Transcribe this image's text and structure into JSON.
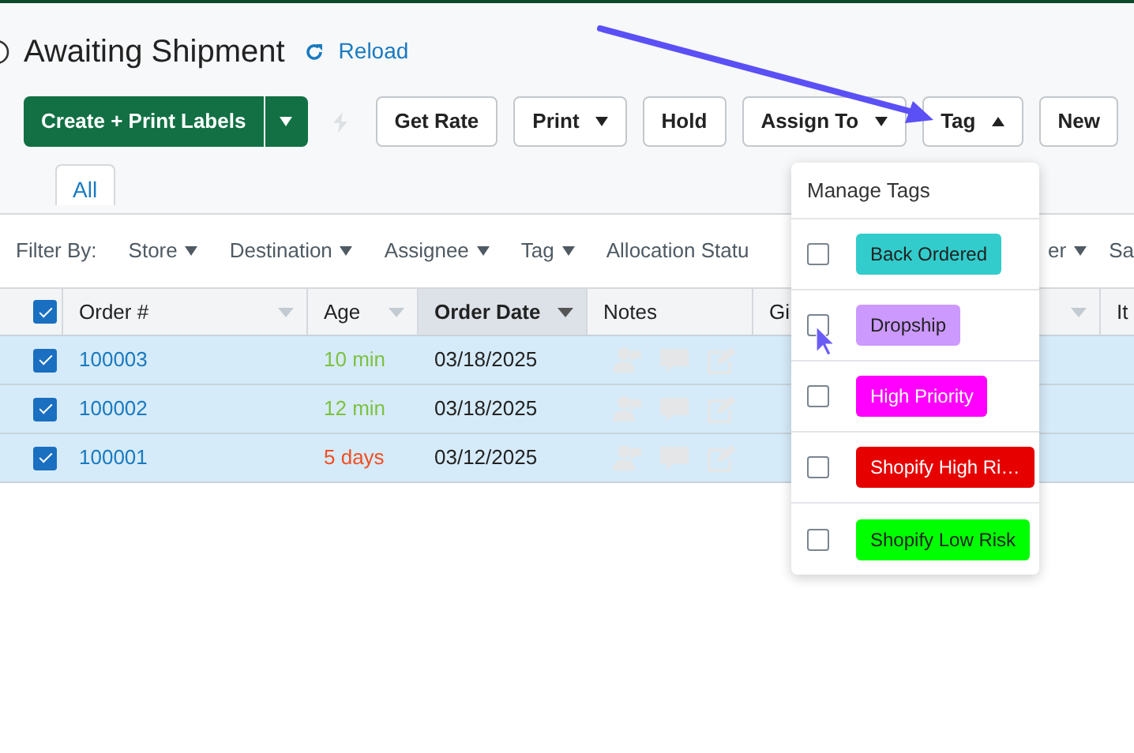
{
  "header": {
    "title": "Awaiting Shipment",
    "reload": "Reload"
  },
  "toolbar": [
    {
      "kind": "split",
      "label": "Create + Print Labels"
    },
    {
      "kind": "icon"
    },
    {
      "kind": "button",
      "label": "Get Rate"
    },
    {
      "kind": "dropdown",
      "label": "Print",
      "expanded": false
    },
    {
      "kind": "button",
      "label": "Hold"
    },
    {
      "kind": "dropdown",
      "label": "Assign To",
      "expanded": false
    },
    {
      "kind": "dropdown",
      "label": "Tag",
      "expanded": true
    },
    {
      "kind": "button",
      "label": "New"
    }
  ],
  "tabs": [
    {
      "label": "All",
      "selected": true
    }
  ],
  "filters": {
    "label": "Filter By:",
    "items": [
      {
        "kind": "dropdown",
        "label": "Store"
      },
      {
        "kind": "dropdown",
        "label": "Destination"
      },
      {
        "kind": "dropdown",
        "label": "Assignee"
      },
      {
        "kind": "dropdown",
        "label": "Tag"
      },
      {
        "kind": "text",
        "label": "Allocation Statu"
      },
      {
        "kind": "gap"
      },
      {
        "kind": "dropdown",
        "label": "er"
      },
      {
        "kind": "text",
        "label": "Sa"
      }
    ]
  },
  "table": {
    "select_all": {
      "checked": true
    },
    "columns": [
      {
        "label": "Order #",
        "sortable": true,
        "sorted": false
      },
      {
        "label": "Age",
        "sortable": true,
        "sorted": false
      },
      {
        "label": "Order Date",
        "sortable": true,
        "sorted": true
      },
      {
        "label": "Notes",
        "sortable": false,
        "sorted": false
      },
      {
        "label": "Gi"
      },
      {
        "sortable": true,
        "sorted": false
      },
      {
        "label": "It"
      }
    ],
    "rows": [
      {
        "selected": true,
        "order": "100003",
        "age": {
          "text": "10 min",
          "color": "#7cc142"
        },
        "order_date": "03/18/2025"
      },
      {
        "selected": true,
        "order": "100002",
        "age": {
          "text": "12 min",
          "color": "#7cc142"
        },
        "order_date": "03/18/2025"
      },
      {
        "selected": true,
        "order": "100001",
        "age": {
          "text": "5 days",
          "color": "#f04e23"
        },
        "order_date": "03/12/2025"
      }
    ]
  },
  "tag_menu": {
    "title": "Manage Tags",
    "items": [
      {
        "label": "Back Ordered",
        "color": "#33cccc",
        "checked": false
      },
      {
        "label": "Dropship",
        "color": "#cc99ff",
        "checked": false
      },
      {
        "label": "High Priority",
        "color": "#ff00ff",
        "checked": false
      },
      {
        "label": "Shopify High Ri…",
        "color": "#e60000",
        "checked": false
      },
      {
        "label": "Shopify Low Risk",
        "color": "#00ff00",
        "checked": false
      }
    ]
  }
}
